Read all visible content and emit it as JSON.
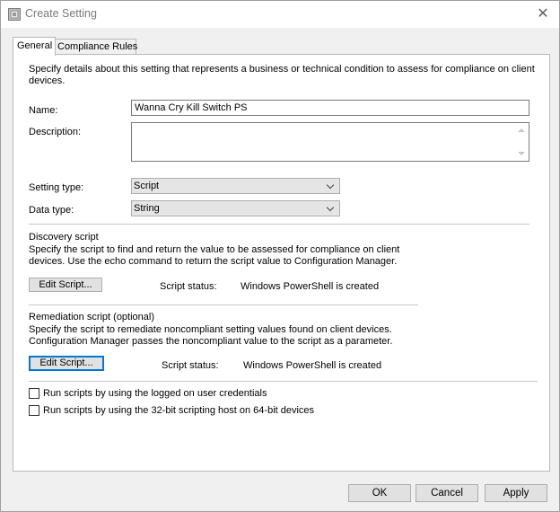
{
  "window": {
    "title": "Create Setting",
    "close_glyph": "✕"
  },
  "tabs": [
    {
      "label": "General",
      "active": true
    },
    {
      "label": "Compliance Rules",
      "active": false
    }
  ],
  "general": {
    "intro_line1": "Specify details about this setting that represents a business or technical condition to assess for compliance on client",
    "intro_line2": "devices.",
    "name_label": "Name:",
    "name_value": "Wanna Cry Kill Switch PS",
    "description_label": "Description:",
    "description_value": "",
    "setting_type_label": "Setting type:",
    "setting_type_value": "Script",
    "data_type_label": "Data type:",
    "data_type_value": "String"
  },
  "discovery": {
    "heading": "Discovery script",
    "desc_line1": "Specify the script to find and return the value to be assessed for compliance on client",
    "desc_line2": "devices. Use the echo command to return the script value to Configuration Manager.",
    "edit_button": "Edit Script...",
    "status_label": "Script status:",
    "status_value": "Windows PowerShell is created"
  },
  "remediation": {
    "heading": "Remediation script (optional)",
    "desc_line1": "Specify the script to remediate noncompliant setting values found on client devices.",
    "desc_line2": "Configuration Manager passes the noncompliant value to the script as a parameter.",
    "edit_button": "Edit Script...",
    "status_label": "Script status:",
    "status_value": "Windows PowerShell is created"
  },
  "options": {
    "run_logged_on": {
      "label": "Run scripts by using the logged on user credentials",
      "checked": false
    },
    "run_32bit": {
      "label": "Run scripts by using the 32-bit scripting host on 64-bit devices",
      "checked": false
    }
  },
  "footer": {
    "ok": "OK",
    "cancel": "Cancel",
    "apply": "Apply"
  },
  "colors": {
    "focus_accent": "#0078d7",
    "button_face": "#e1e1e1",
    "dialog_bg": "#f0f0f0"
  }
}
